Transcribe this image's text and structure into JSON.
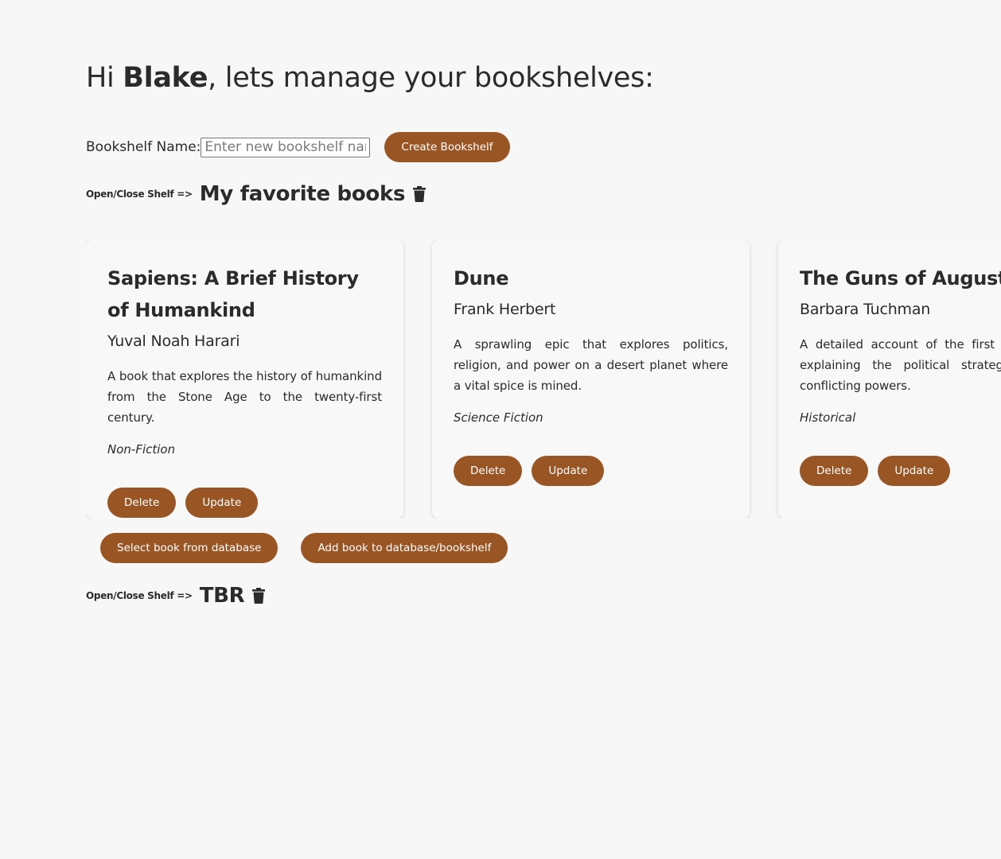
{
  "greeting": {
    "prefix": "Hi ",
    "user": "Blake",
    "suffix": ", lets manage your bookshelves:"
  },
  "create": {
    "label": "Bookshelf Name:",
    "placeholder": "Enter new bookshelf name",
    "button": "Create Bookshelf"
  },
  "shelves": [
    {
      "toggle": "Open/Close Shelf =>",
      "name": "My favorite books",
      "icon": "trash-icon"
    },
    {
      "toggle": "Open/Close Shelf =>",
      "name": "TBR",
      "icon": "trash-icon"
    }
  ],
  "books": [
    {
      "title": "Sapiens: A Brief History of Humankind",
      "author": "Yuval Noah Harari",
      "description": "A book that explores the history of humankind from the Stone Age to the twenty-first century.",
      "genre": "Non-Fiction",
      "delete": "Delete",
      "update": "Update"
    },
    {
      "title": "Dune",
      "author": "Frank Herbert",
      "description": "A sprawling epic that explores politics, religion, and power on a desert planet where a vital spice is mined.",
      "genre": "Science Fiction",
      "delete": "Delete",
      "update": "Update"
    },
    {
      "title": "The Guns of August",
      "author": "Barbara Tuchman",
      "description": "A detailed account of the first mon War I, explaining the political strategies of the conflicting powers.",
      "genre": "Historical",
      "delete": "Delete",
      "update": "Update"
    }
  ],
  "shelf_actions": {
    "select": "Select book from database",
    "add": "Add book to database/bookshelf"
  },
  "colors": {
    "accent": "#9a5524",
    "background": "#f7f7f7",
    "text": "#2b2b2b"
  }
}
